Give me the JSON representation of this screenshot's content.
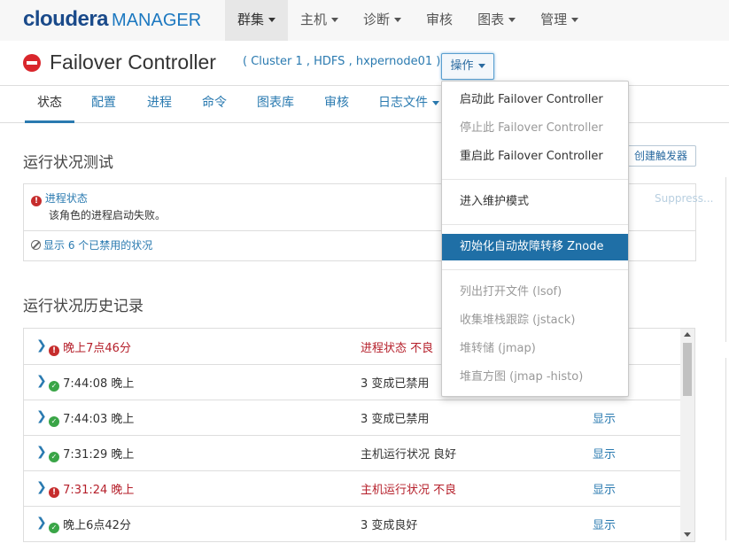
{
  "logo": {
    "brand": "cloudera",
    "product": "MANAGER"
  },
  "nav": [
    {
      "label": "群集",
      "active": true
    },
    {
      "label": "主机"
    },
    {
      "label": "诊断"
    },
    {
      "label": "审核"
    },
    {
      "label": "图表"
    },
    {
      "label": "管理"
    }
  ],
  "header": {
    "title": "Failover Controller",
    "breadcrumb": "( Cluster 1 , HDFS , hxpernode01 )",
    "ops_label": "操作"
  },
  "tabs": [
    "状态",
    "配置",
    "进程",
    "命令",
    "图表库",
    "审核",
    "日志文件"
  ],
  "health": {
    "title": "运行状况测试",
    "create_trigger": "创建触发器",
    "process_state": "进程状态",
    "process_desc": "该角色的进程启动失败。",
    "suppress": "Suppress...",
    "show_disabled": "显示 6 个已禁用的状况"
  },
  "history": {
    "title": "运行状况历史记录",
    "rows": [
      {
        "status": "bad",
        "time": "晚上7点46分",
        "event": "进程状态 不良",
        "action": ""
      },
      {
        "status": "good",
        "time": "7:44:08 晚上",
        "event": "3 变成已禁用",
        "action": ""
      },
      {
        "status": "good",
        "time": "7:44:03 晚上",
        "event": "3 变成已禁用",
        "action": "显示"
      },
      {
        "status": "good",
        "time": "7:31:29 晚上",
        "event": "主机运行状况 良好",
        "action": "显示"
      },
      {
        "status": "bad",
        "time": "7:31:24 晚上",
        "event": "主机运行状况 不良",
        "action": "显示"
      },
      {
        "status": "good",
        "time": "晚上6点42分",
        "event": "3 变成良好",
        "action": "显示"
      }
    ]
  },
  "dropdown": {
    "items": [
      {
        "label": "启动此 Failover Controller",
        "state": "normal"
      },
      {
        "label": "停止此 Failover Controller",
        "state": "disabled"
      },
      {
        "label": "重启此 Failover Controller",
        "state": "normal"
      },
      {
        "label": "进入维护模式",
        "state": "normal"
      },
      {
        "label": "初始化自动故障转移 Znode",
        "state": "highlighted"
      },
      {
        "label": "列出打开文件 (lsof)",
        "state": "disabled"
      },
      {
        "label": "收集堆栈跟踪 (jstack)",
        "state": "disabled"
      },
      {
        "label": "堆转储 (jmap)",
        "state": "disabled"
      },
      {
        "label": "堆直方图 (jmap -histo)",
        "state": "disabled"
      }
    ]
  },
  "colors": {
    "link": "#2a7ab0",
    "bad": "#b51f2a",
    "good_dot": "#3aa547",
    "highlight": "#1f6fa6"
  }
}
